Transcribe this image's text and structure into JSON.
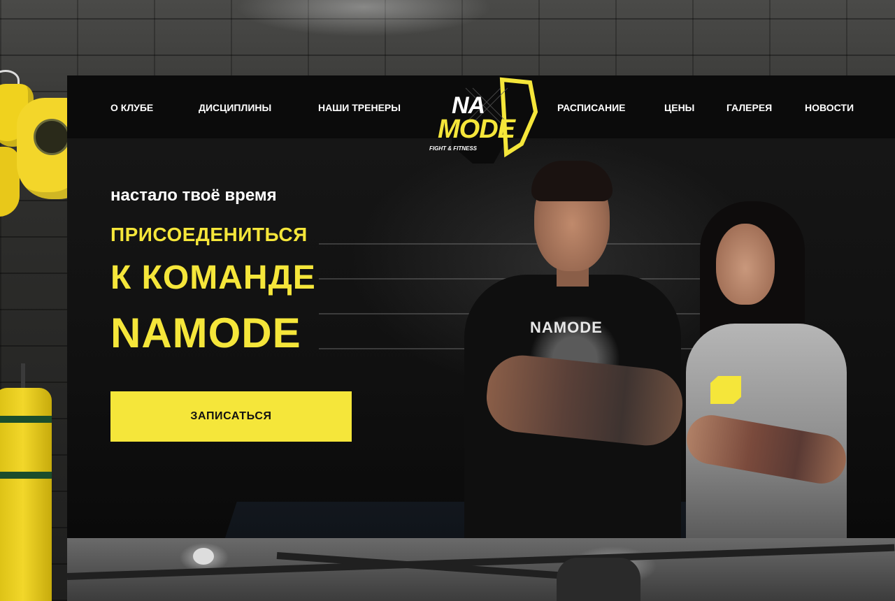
{
  "brand": {
    "logo_text_top": "NA",
    "logo_text_main": "MODE",
    "logo_subtext": "FIGHT & FITNESS",
    "accent_color": "#f5e63a"
  },
  "nav": {
    "left": [
      {
        "label": "О КЛУБЕ"
      },
      {
        "label": "ДИСЦИПЛИНЫ"
      },
      {
        "label": "НАШИ ТРЕНЕРЫ"
      }
    ],
    "right": [
      {
        "label": "РАСПИСАНИЕ"
      },
      {
        "label": "ЦЕНЫ"
      },
      {
        "label": "ГАЛЕРЕЯ"
      },
      {
        "label": "НОВОСТИ"
      }
    ]
  },
  "hero": {
    "tagline": "настало твоё время",
    "line1": "ПРИСОЕДЕНИТЬСЯ",
    "line2": "К КОМАНДЕ",
    "line3": "NAMODE",
    "cta_label": "ЗАПИСАТЬСЯ",
    "shirt_print": "NAMODE"
  }
}
